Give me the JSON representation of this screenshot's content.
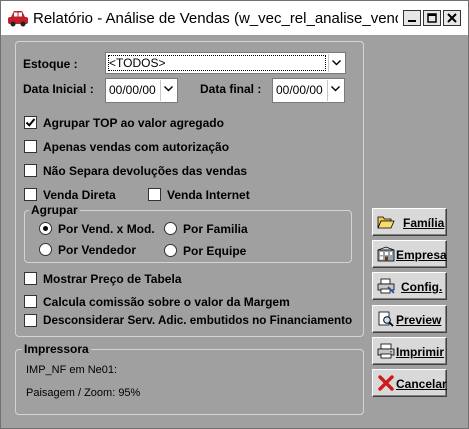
{
  "window": {
    "title": "Relatório - Análise de Vendas (w_vec_rel_analise_vend..."
  },
  "filters": {
    "estoque_label": "Estoque :",
    "estoque_value": "<TODOS>",
    "data_inicial_label": "Data Inicial :",
    "data_inicial_value": "00/00/00",
    "data_final_label": "Data final :",
    "data_final_value": "00/00/00"
  },
  "options": {
    "agrupar_top": {
      "label": "Agrupar TOP ao valor agregado",
      "checked": true
    },
    "apenas_autorizacao": {
      "label": "Apenas vendas com autorização",
      "checked": false
    },
    "nao_separa_devolucoes": {
      "label": "Não Separa devoluções das vendas",
      "checked": false
    },
    "venda_direta": {
      "label": "Venda Direta",
      "checked": false
    },
    "venda_internet": {
      "label": "Venda Internet",
      "checked": false
    }
  },
  "agrupar": {
    "title": "Agrupar",
    "por_vend_mod": {
      "label": "Por Vend. x Mod.",
      "selected": true
    },
    "por_familia": {
      "label": "Por Familia",
      "selected": false
    },
    "por_vendedor": {
      "label": "Por Vendedor",
      "selected": false
    },
    "por_equipe": {
      "label": "Por Equipe",
      "selected": false
    }
  },
  "extra_options": {
    "mostrar_preco": {
      "label": "Mostrar Preço de Tabela",
      "checked": false
    },
    "comissao_margem": {
      "label": "Calcula comissão sobre o valor da Margem",
      "checked": false
    },
    "desconsiderar_serv": {
      "label": "Desconsiderar Serv. Adic. embutidos no Financiamento",
      "checked": false
    }
  },
  "printer": {
    "title": "Impressora",
    "line1": "IMP_NF em Ne01:",
    "line2": "Paisagem / Zoom: 95%"
  },
  "buttons": {
    "familia": "Família",
    "empresa": "Empresa",
    "config": "Config.",
    "preview": "Preview",
    "imprimir": "Imprimir",
    "cancelar": "Cancelar"
  },
  "colors": {
    "window_bg": "#a0a0a0",
    "button_face": "#d9d9d9",
    "panel_border": "#d4d4d4"
  }
}
